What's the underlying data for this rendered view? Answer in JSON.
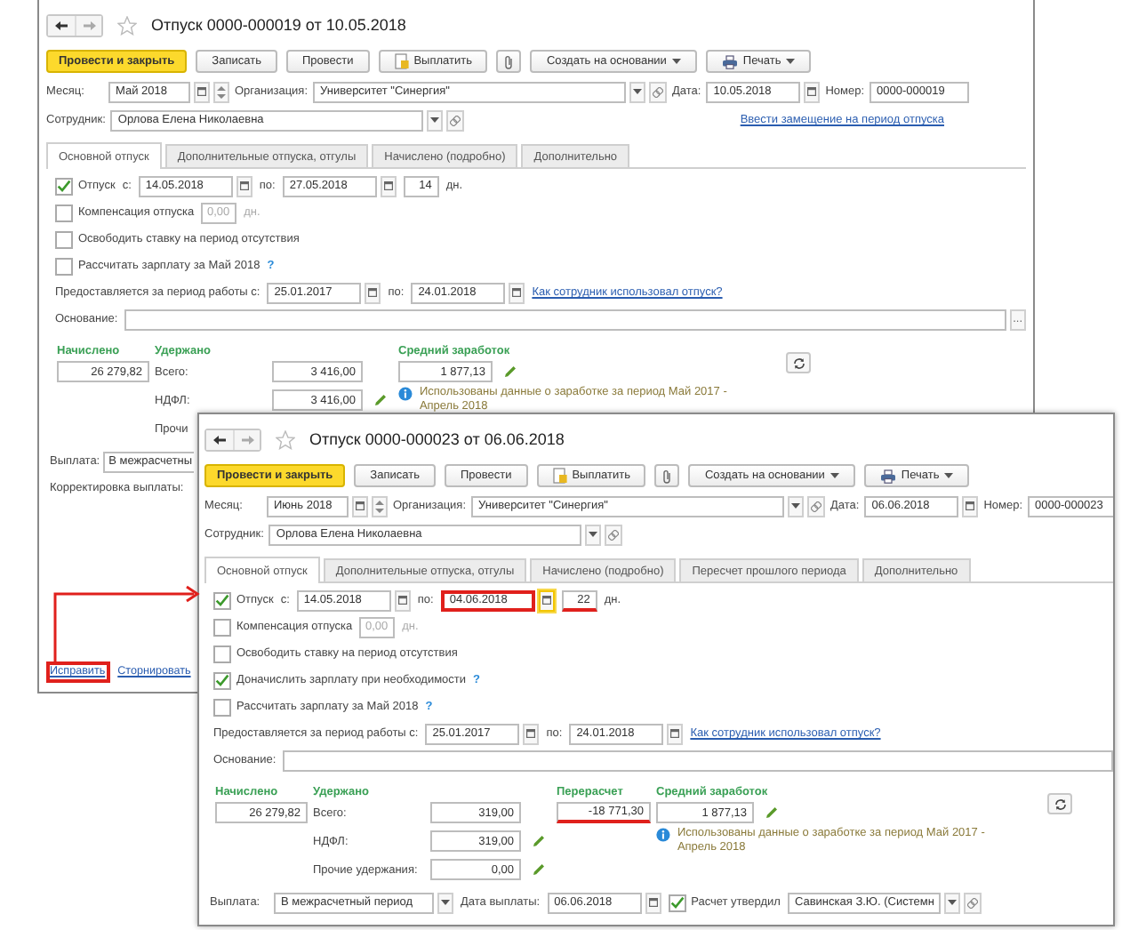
{
  "windows": [
    {
      "kind": "back",
      "title": "Отпуск 0000-000019 от 10.05.2018",
      "toolbar": [
        {
          "kind": "primary",
          "label": "Провести и закрыть"
        },
        {
          "kind": "plain",
          "label": "Записать"
        },
        {
          "kind": "plain",
          "label": "Провести"
        },
        {
          "kind": "pay",
          "label": "Выплатить"
        },
        {
          "kind": "attach"
        },
        {
          "kind": "menu",
          "label": "Создать на основании"
        },
        {
          "kind": "print",
          "label": "Печать"
        }
      ],
      "header_rows": [
        [
          {
            "kind": "label",
            "text": "Месяц:"
          },
          {
            "kind": "month",
            "value": "Май 2018"
          },
          {
            "kind": "label",
            "text": "Организация:"
          },
          {
            "kind": "select",
            "value": "Университет \"Синергия\""
          },
          {
            "kind": "label",
            "text": "Дата:"
          },
          {
            "kind": "date",
            "value": "10.05.2018"
          },
          {
            "kind": "label",
            "text": "Номер:"
          },
          {
            "kind": "text",
            "value": "0000-000019"
          }
        ],
        [
          {
            "kind": "label",
            "text": "Сотрудник:"
          },
          {
            "kind": "select",
            "value": "Орлова Елена Николаевна"
          },
          {
            "kind": "link",
            "text": "Ввести замещение на период отпуска"
          }
        ]
      ],
      "tabs": [
        {
          "label": "Основной отпуск",
          "selected": true
        },
        {
          "label": "Дополнительные отпуска, отгулы",
          "selected": false
        },
        {
          "label": "Начислено (подробно)",
          "selected": false
        },
        {
          "label": "Дополнительно",
          "selected": false
        }
      ],
      "form_rows": [
        [
          {
            "kind": "checkbox",
            "label": "Отпуск",
            "checked": true
          },
          {
            "kind": "label",
            "text": "с:"
          },
          {
            "kind": "date",
            "value": "14.05.2018"
          },
          {
            "kind": "label",
            "text": "по:"
          },
          {
            "kind": "date",
            "value": "27.05.2018"
          },
          {
            "kind": "days",
            "value": "14"
          },
          {
            "kind": "label",
            "text": "дн."
          }
        ],
        [
          {
            "kind": "checkbox",
            "label": "Компенсация отпуска",
            "checked": false
          },
          {
            "kind": "small",
            "value": "0,00",
            "disabled": true
          },
          {
            "kind": "label",
            "text": "дн.",
            "disabled": true
          }
        ],
        [
          {
            "kind": "checkbox",
            "label": "Освободить ставку на период отсутствия",
            "checked": false
          }
        ],
        [
          {
            "kind": "checkbox",
            "label": "Рассчитать зарплату за Май 2018",
            "checked": false
          },
          {
            "kind": "help",
            "text": "?"
          }
        ],
        [
          {
            "kind": "label",
            "text": "Предоставляется за период работы с:"
          },
          {
            "kind": "date",
            "value": "25.01.2017"
          },
          {
            "kind": "label",
            "text": "по:"
          },
          {
            "kind": "date",
            "value": "24.01.2018"
          },
          {
            "kind": "link",
            "text": "Как сотрудник использовал отпуск?"
          }
        ],
        [
          {
            "kind": "label",
            "text": "Основание:"
          },
          {
            "kind": "memo",
            "button_text": "..."
          }
        ]
      ],
      "money": {
        "accrued": {
          "heading": "Начислено",
          "value": "26 279,82"
        },
        "withheld": {
          "heading": "Удержано",
          "rows": [
            {
              "label": "Всего:",
              "value": "3 416,00",
              "editable": false
            },
            {
              "label": "НДФЛ:",
              "value": "3 416,00",
              "editable": true
            },
            {
              "label": "Прочи"
            }
          ]
        },
        "average": {
          "heading": "Средний заработок",
          "value": "1 877,13",
          "editable": true
        },
        "note": "Использованы данные о заработке за период Май 2017 - Апрель 2018"
      },
      "footer_rows": [
        [
          {
            "kind": "label",
            "text": "Выплата:"
          },
          {
            "kind": "cut-choice",
            "value": "В межрасчетны"
          }
        ],
        [
          {
            "kind": "label",
            "text": "Корректировка выплаты:"
          }
        ]
      ],
      "links": [
        {
          "text": "Исправить",
          "highlighted": true
        },
        {
          "text": "Сторнировать",
          "highlighted": false
        }
      ]
    },
    {
      "kind": "front",
      "title": "Отпуск 0000-000023 от 06.06.2018",
      "toolbar": [
        {
          "kind": "primary",
          "label": "Провести и закрыть"
        },
        {
          "kind": "plain",
          "label": "Записать"
        },
        {
          "kind": "plain",
          "label": "Провести"
        },
        {
          "kind": "pay",
          "label": "Выплатить"
        },
        {
          "kind": "attach"
        },
        {
          "kind": "menu",
          "label": "Создать на основании"
        },
        {
          "kind": "print",
          "label": "Печать"
        }
      ],
      "header_rows": [
        [
          {
            "kind": "label",
            "text": "Месяц:"
          },
          {
            "kind": "month",
            "value": "Июнь 2018"
          },
          {
            "kind": "label",
            "text": "Организация:"
          },
          {
            "kind": "select",
            "value": "Университет \"Синергия\""
          },
          {
            "kind": "label",
            "text": "Дата:"
          },
          {
            "kind": "date",
            "value": "06.06.2018"
          },
          {
            "kind": "label",
            "text": "Номер:"
          },
          {
            "kind": "text",
            "value": "0000-000023"
          }
        ],
        [
          {
            "kind": "label",
            "text": "Сотрудник:"
          },
          {
            "kind": "select",
            "value": "Орлова Елена Николаевна"
          }
        ]
      ],
      "tabs": [
        {
          "label": "Основной отпуск",
          "selected": true
        },
        {
          "label": "Дополнительные отпуска, отгулы",
          "selected": false
        },
        {
          "label": "Начислено (подробно)",
          "selected": false
        },
        {
          "label": "Пересчет прошлого периода",
          "selected": false
        },
        {
          "label": "Дополнительно",
          "selected": false
        }
      ],
      "form_rows": [
        [
          {
            "kind": "checkbox",
            "label": "Отпуск",
            "checked": true
          },
          {
            "kind": "label",
            "text": "с:"
          },
          {
            "kind": "date",
            "value": "14.05.2018"
          },
          {
            "kind": "label",
            "text": "по:"
          },
          {
            "kind": "date",
            "value": "04.06.2018",
            "highlighted": true,
            "focused": true
          },
          {
            "kind": "days",
            "value": "22",
            "underlined": true
          },
          {
            "kind": "label",
            "text": "дн."
          }
        ],
        [
          {
            "kind": "checkbox",
            "label": "Компенсация отпуска",
            "checked": false
          },
          {
            "kind": "small",
            "value": "0,00",
            "disabled": true
          },
          {
            "kind": "label",
            "text": "дн.",
            "disabled": true
          }
        ],
        [
          {
            "kind": "checkbox",
            "label": "Освободить ставку на период отсутствия",
            "checked": false
          }
        ],
        [
          {
            "kind": "checkbox",
            "label": "Доначислить зарплату при необходимости",
            "checked": true
          },
          {
            "kind": "help",
            "text": "?"
          }
        ],
        [
          {
            "kind": "checkbox",
            "label": "Рассчитать зарплату за Май 2018",
            "checked": false
          },
          {
            "kind": "help",
            "text": "?"
          }
        ],
        [
          {
            "kind": "label",
            "text": "Предоставляется за период работы с:"
          },
          {
            "kind": "date",
            "value": "25.01.2017"
          },
          {
            "kind": "label",
            "text": "по:"
          },
          {
            "kind": "date",
            "value": "24.01.2018"
          },
          {
            "kind": "link",
            "text": "Как сотрудник использовал отпуск?"
          }
        ],
        [
          {
            "kind": "label",
            "text": "Основание:"
          },
          {
            "kind": "memo"
          }
        ]
      ],
      "money": {
        "accrued": {
          "heading": "Начислено",
          "value": "26 279,82"
        },
        "withheld": {
          "heading": "Удержано",
          "rows": [
            {
              "label": "Всего:",
              "value": "319,00",
              "editable": false
            },
            {
              "label": "НДФЛ:",
              "value": "319,00",
              "editable": true
            },
            {
              "label": "Прочие удержания:",
              "value": "0,00",
              "editable": true
            }
          ]
        },
        "recalc": {
          "heading": "Перерасчет",
          "value": "-18 771,30",
          "underlined": true
        },
        "average": {
          "heading": "Средний заработок",
          "value": "1 877,13",
          "editable": true
        },
        "note": "Использованы данные о заработке за период Май 2017 - Апрель 2018"
      },
      "footer_rows": [
        [
          {
            "kind": "label",
            "text": "Выплата:"
          },
          {
            "kind": "choice",
            "value": "В межрасчетный период"
          },
          {
            "kind": "label",
            "text": "Дата выплаты:"
          },
          {
            "kind": "date",
            "value": "06.06.2018"
          },
          {
            "kind": "checkbox",
            "label": "Расчет утвердил",
            "checked": true
          },
          {
            "kind": "ref",
            "value": "Савинская З.Ю. (Системн"
          }
        ]
      ]
    }
  ]
}
